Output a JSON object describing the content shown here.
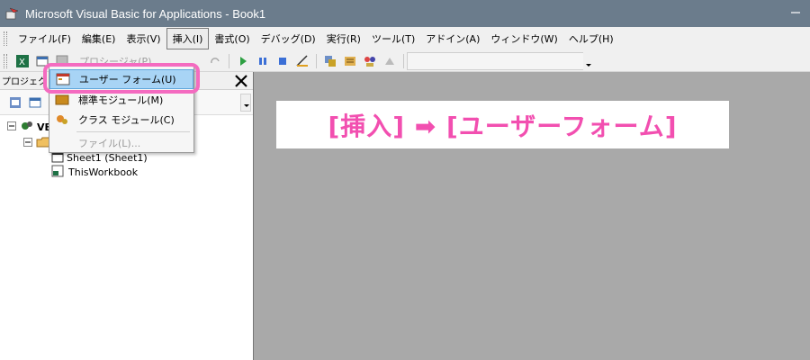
{
  "window": {
    "title": "Microsoft Visual Basic for Applications - Book1",
    "minimize_icon": "minimize-icon"
  },
  "menubar": {
    "items": [
      {
        "label": "ファイル(F)"
      },
      {
        "label": "編集(E)"
      },
      {
        "label": "表示(V)"
      },
      {
        "label": "挿入(I)"
      },
      {
        "label": "書式(O)"
      },
      {
        "label": "デバッグ(D)"
      },
      {
        "label": "実行(R)"
      },
      {
        "label": "ツール(T)"
      },
      {
        "label": "アドイン(A)"
      },
      {
        "label": "ウィンドウ(W)"
      },
      {
        "label": "ヘルプ(H)"
      }
    ]
  },
  "toolbar": {
    "procedure_label": "プロシージャ(P)"
  },
  "project_panel": {
    "header_label": "プロジェク",
    "tree": {
      "root_label": "VB",
      "sheet_label": "Sheet1 (Sheet1)",
      "workbook_label": "ThisWorkbook"
    }
  },
  "insert_menu": {
    "items": [
      {
        "label": "ユーザー フォーム(U)",
        "highlighted": true
      },
      {
        "label": "標準モジュール(M)"
      },
      {
        "label": "クラス モジュール(C)"
      },
      {
        "label": "ファイル(L)...",
        "disabled": true
      }
    ]
  },
  "annotation": {
    "text": "[挿入] ➡ [ユーザーフォーム]",
    "color": "#f24fb0"
  },
  "colors": {
    "titlebar": "#6b7c8c",
    "highlight": "#a8d4f5",
    "callout": "#f46bc0"
  }
}
